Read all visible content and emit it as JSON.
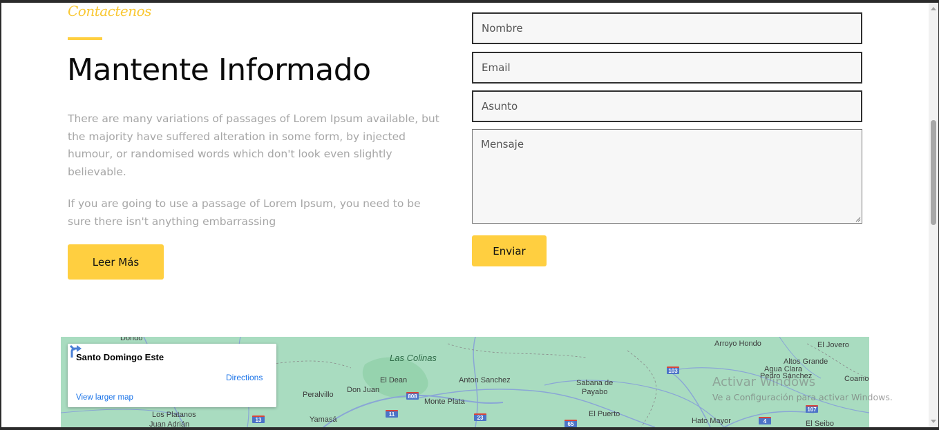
{
  "section": {
    "eyebrow": "Contactenos",
    "title": "Mantente Informado",
    "paragraph_1": "There are many variations of passages of Lorem Ipsum available, but the majority have suffered alteration in some form, by injected humour, or randomised words which don't look even slightly believable.",
    "paragraph_2": "If you are going to use a passage of Lorem Ipsum, you need to be sure there isn't anything embarrassing",
    "read_more_label": "Leer Más",
    "accent_color": "#ffcf40"
  },
  "form": {
    "name_placeholder": "Nombre",
    "email_placeholder": "Email",
    "subject_placeholder": "Asunto",
    "message_placeholder": "Mensaje",
    "submit_label": "Enviar"
  },
  "map": {
    "place_name": "Santo Domingo Este",
    "directions_label": "Directions",
    "larger_map_label": "View larger map",
    "labels": {
      "top_left_cut": "Dondo",
      "las_colinas": "Las Colinas",
      "el_dean": "El Dean",
      "anton_sanchez": "Anton Sanchez",
      "sabana_de_payabo_1": "Sabana de",
      "sabana_de_payabo_2": "Payabo",
      "arroyo_hondo": "Arroyo Hondo",
      "el_jovero": "El Jovero",
      "altos_grande": "Altos Grande",
      "coamo": "Coamo",
      "agua_clara": "Agua Clara",
      "pedro_sanchez": "Pedro Sánchez",
      "peravillo": "Peralvillo",
      "don_juan": "Don Juan",
      "monte_plata": "Monte Plata",
      "los_platanos": "Los Platanos",
      "juan_adrian": "Juan Adrián",
      "yamasa": "Yamasá",
      "el_puerto": "El Puerto",
      "hato_mayor": "Hato Mayor",
      "el_seibo": "El Seibo"
    },
    "shields": {
      "r103": "103",
      "r808": "808",
      "r11": "11",
      "r13": "13",
      "r23": "23",
      "r65": "65",
      "r4": "4",
      "r107": "107"
    },
    "water_color": "#a9dcc0"
  },
  "watermark": {
    "title": "Activar Windows",
    "subtitle": "Ve a Configuración para activar Windows."
  }
}
